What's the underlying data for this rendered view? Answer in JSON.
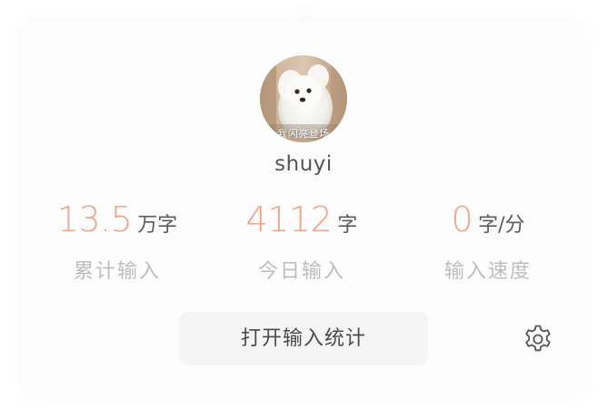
{
  "profile": {
    "username": "shuyi",
    "avatar_caption": "我闪亮登场"
  },
  "stats": [
    {
      "value": "13.5",
      "unit": "万字",
      "label": "累计输入"
    },
    {
      "value": "4112",
      "unit": "字",
      "label": "今日输入"
    },
    {
      "value": "0",
      "unit": "字/分",
      "label": "输入速度"
    }
  ],
  "actions": {
    "open_stats_label": "打开输入统计",
    "settings_icon": "gear-icon"
  },
  "colors": {
    "accent": "#efa586",
    "label": "#bdbdbd",
    "text": "#555555",
    "button_bg": "#f5f5f5"
  }
}
